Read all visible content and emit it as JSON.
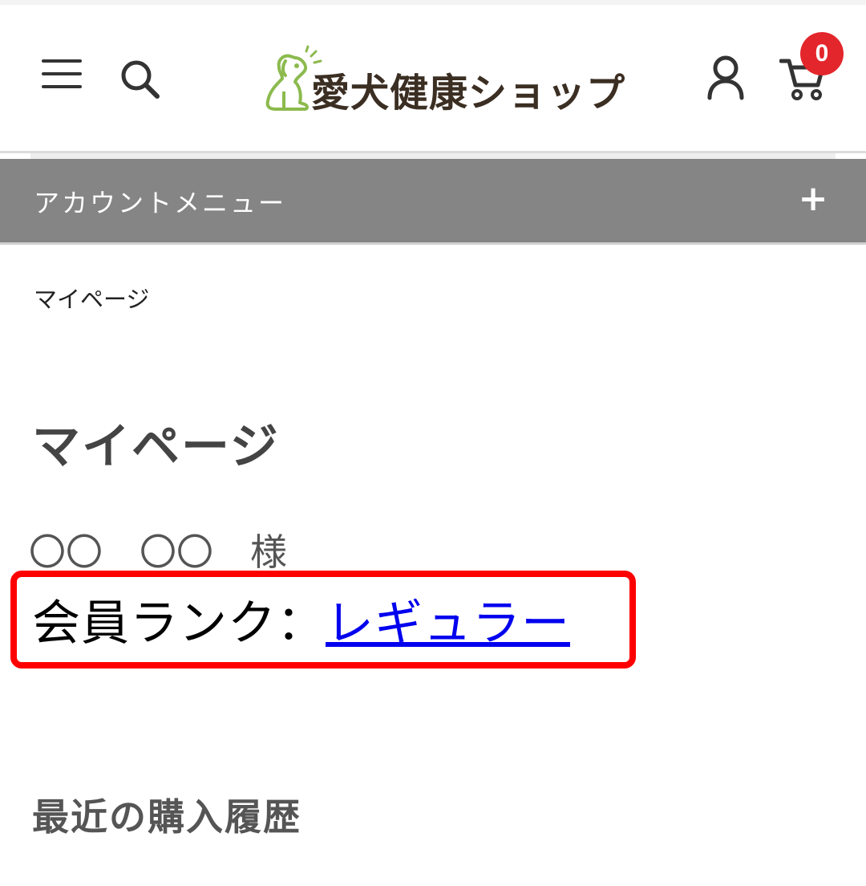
{
  "header": {
    "logo_text": "愛犬健康ショップ",
    "cart_count": "0",
    "brand_colors": {
      "logo_green": "#8cba4e",
      "logo_brown": "#3b2e22",
      "badge_red": "#e3262b"
    }
  },
  "account_menu": {
    "label": "アカウントメニュー",
    "toggle": "+",
    "background": "#858585"
  },
  "breadcrumb": {
    "current": "マイページ"
  },
  "main": {
    "title": "マイページ",
    "customer_name": "〇〇　〇〇　様",
    "member_rank": {
      "label": "会員ランク：",
      "value": "レギュラー",
      "highlight_color": "#ff0000"
    },
    "recent_purchases_heading": "最近の購入履歴"
  },
  "icons": [
    "hamburger-menu-icon",
    "search-icon",
    "dog-logo-icon",
    "user-account-icon",
    "shopping-cart-icon",
    "plus-icon"
  ]
}
